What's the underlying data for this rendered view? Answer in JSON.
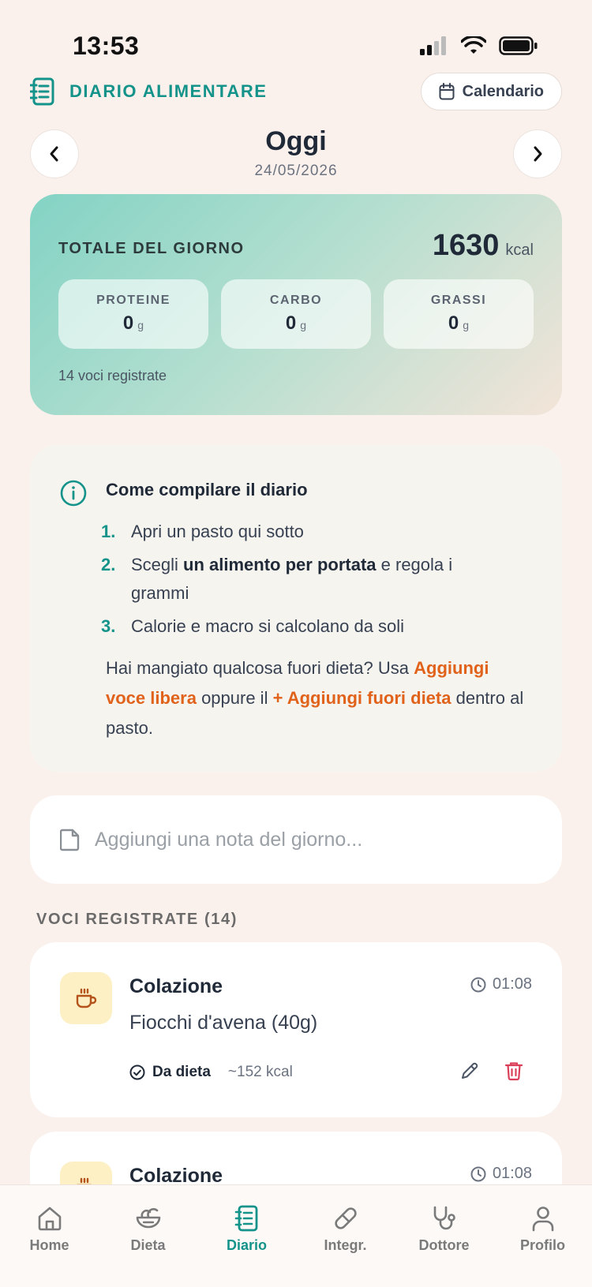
{
  "status_bar": {
    "time": "13:53"
  },
  "header": {
    "title": "DIARIO ALIMENTARE",
    "calendar_label": "Calendario"
  },
  "day": {
    "title": "Oggi",
    "date": "24/05/2026"
  },
  "totals": {
    "label": "TOTALE DEL GIORNO",
    "kcal": "1630",
    "kcal_unit": "kcal",
    "macros": [
      {
        "name": "PROTEINE",
        "value": "0",
        "unit": "g"
      },
      {
        "name": "CARBO",
        "value": "0",
        "unit": "g"
      },
      {
        "name": "GRASSI",
        "value": "0",
        "unit": "g"
      }
    ],
    "entries_count": "14 voci registrate"
  },
  "info": {
    "title": "Come compilare il diario",
    "steps": [
      {
        "num": "1.",
        "pre": "Apri un pasto qui sotto",
        "bold": "",
        "post": ""
      },
      {
        "num": "2.",
        "pre": "Scegli ",
        "bold": "un alimento per portata",
        "post": " e regola i grammi"
      },
      {
        "num": "3.",
        "pre": "Calorie e macro si calcolano da soli",
        "bold": "",
        "post": ""
      }
    ],
    "footer": {
      "part1": "Hai mangiato qualcosa fuori dieta? Usa ",
      "link1": "Aggiungi voce libera",
      "part2": " oppure il ",
      "link2": "+ Aggiungi fuori dieta",
      "part3": " dentro al pasto."
    }
  },
  "note": {
    "placeholder": "Aggiungi una nota del giorno..."
  },
  "entries_section": {
    "label": "VOCI REGISTRATE (14)"
  },
  "entries": [
    {
      "meal": "Colazione",
      "time": "01:08",
      "food": "Fiocchi d'avena (40g)",
      "tag": "Da dieta",
      "kcal": "~152 kcal"
    },
    {
      "meal": "Colazione",
      "time": "01:08",
      "food": "",
      "tag": "",
      "kcal": ""
    }
  ],
  "tabbar": {
    "active": "Diario",
    "tabs": [
      {
        "label": "Home",
        "icon": "home-icon"
      },
      {
        "label": "Dieta",
        "icon": "salad-bowl-icon"
      },
      {
        "label": "Diario",
        "icon": "notebook-icon"
      },
      {
        "label": "Integr.",
        "icon": "pill-icon"
      },
      {
        "label": "Dottore",
        "icon": "stethoscope-icon"
      },
      {
        "label": "Profilo",
        "icon": "user-icon"
      }
    ]
  },
  "colors": {
    "accent": "#14938a",
    "orange": "#e0621b",
    "delete": "#dc3f5a",
    "background": "#fbf1ec"
  }
}
